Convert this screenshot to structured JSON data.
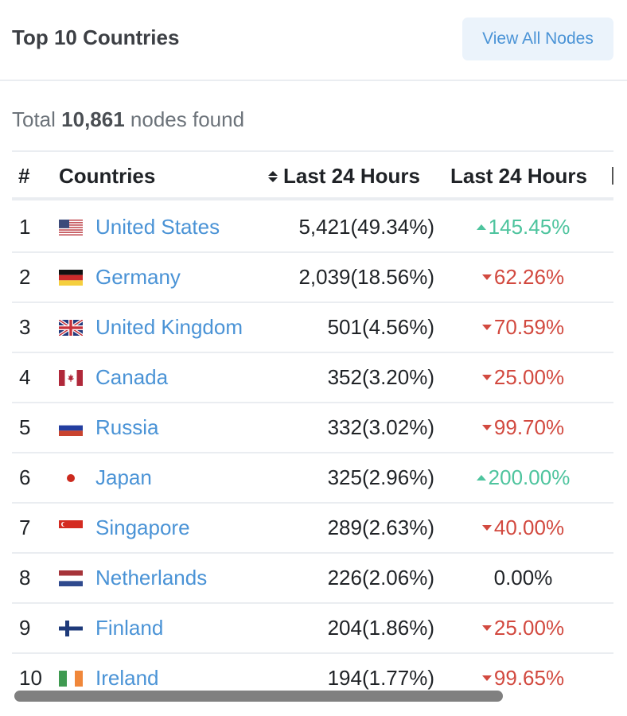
{
  "header": {
    "title": "Top 10 Countries",
    "view_all_label": "View All Nodes"
  },
  "summary": {
    "prefix": "Total",
    "total": "10,861",
    "suffix": "nodes found"
  },
  "table": {
    "columns": {
      "rank": "#",
      "country": "Countries",
      "nodes": "Last 24 Hours",
      "change": "Last 24 Hours"
    },
    "rows": [
      {
        "rank": "1",
        "flag": "us-flag-icon",
        "country": "United States",
        "nodes": "5,421(49.34%)",
        "change": "145.45%",
        "trend": "up"
      },
      {
        "rank": "2",
        "flag": "de-flag-icon",
        "country": "Germany",
        "nodes": "2,039(18.56%)",
        "change": "62.26%",
        "trend": "down"
      },
      {
        "rank": "3",
        "flag": "gb-flag-icon",
        "country": "United Kingdom",
        "nodes": "501(4.56%)",
        "change": "70.59%",
        "trend": "down"
      },
      {
        "rank": "4",
        "flag": "ca-flag-icon",
        "country": "Canada",
        "nodes": "352(3.20%)",
        "change": "25.00%",
        "trend": "down"
      },
      {
        "rank": "5",
        "flag": "ru-flag-icon",
        "country": "Russia",
        "nodes": "332(3.02%)",
        "change": "99.70%",
        "trend": "down"
      },
      {
        "rank": "6",
        "flag": "jp-flag-icon",
        "country": "Japan",
        "nodes": "325(2.96%)",
        "change": "200.00%",
        "trend": "up"
      },
      {
        "rank": "7",
        "flag": "sg-flag-icon",
        "country": "Singapore",
        "nodes": "289(2.63%)",
        "change": "40.00%",
        "trend": "down"
      },
      {
        "rank": "8",
        "flag": "nl-flag-icon",
        "country": "Netherlands",
        "nodes": "226(2.06%)",
        "change": "0.00%",
        "trend": "flat"
      },
      {
        "rank": "9",
        "flag": "fi-flag-icon",
        "country": "Finland",
        "nodes": "204(1.86%)",
        "change": "25.00%",
        "trend": "down"
      },
      {
        "rank": "10",
        "flag": "ie-flag-icon",
        "country": "Ireland",
        "nodes": "194(1.77%)",
        "change": "99.65%",
        "trend": "down"
      }
    ]
  },
  "colors": {
    "link": "#4a93d6",
    "up": "#4ec49e",
    "down": "#d2493f",
    "button_bg": "#ebf3fb"
  }
}
